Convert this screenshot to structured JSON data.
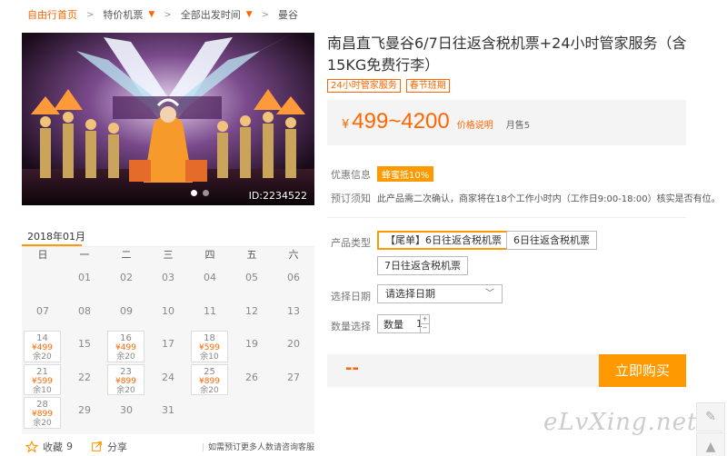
{
  "breadcrumb": {
    "items": [
      "自由行首页",
      "特价机票",
      "全部出发时间",
      "曼谷"
    ]
  },
  "hero": {
    "image_id": "ID:2234522"
  },
  "product": {
    "title": "南昌直飞曼谷6/7日往返含税机票+24小时管家服务（含15KG免费行李）",
    "tags": [
      "24小时管家服务",
      "春节班期"
    ],
    "price_symbol": "¥",
    "price_range": "499~4200",
    "price_note": "价格说明",
    "monthly_sales": "月售5"
  },
  "info": {
    "discount_label": "优惠信息",
    "discount_badge": "蜂蜜抵10%",
    "notice_label": "预订须知",
    "notice_text": "此产品需二次确认，商家将在18个工作小时内（工作日9:00-18:00）核实是否有位。"
  },
  "form": {
    "type_label": "产品类型",
    "types": [
      "【尾单】6日往返含税机票",
      "6日往返含税机票",
      "7日往返含税机票"
    ],
    "date_label": "选择日期",
    "date_placeholder": "请选择日期",
    "qty_label": "数量选择",
    "qty_inner_label": "数量",
    "qty_value": "1"
  },
  "buy": {
    "price_placeholder": "--",
    "button_label": "立即购买"
  },
  "calendar": {
    "month": "2018年01月",
    "weekdays": [
      "日",
      "一",
      "二",
      "三",
      "四",
      "五",
      "六"
    ],
    "rows": [
      [
        {
          "d": ""
        },
        {
          "d": "01"
        },
        {
          "d": "02"
        },
        {
          "d": "03"
        },
        {
          "d": "04"
        },
        {
          "d": "05"
        },
        {
          "d": "06"
        }
      ],
      [
        {
          "d": "07"
        },
        {
          "d": "08"
        },
        {
          "d": "09"
        },
        {
          "d": "10"
        },
        {
          "d": "11"
        },
        {
          "d": "12"
        },
        {
          "d": "13"
        }
      ],
      [
        {
          "d": "14",
          "p": "¥499",
          "r": "余20"
        },
        {
          "d": "15"
        },
        {
          "d": "16",
          "p": "¥499",
          "r": "余20"
        },
        {
          "d": "17"
        },
        {
          "d": "18",
          "p": "¥599",
          "r": "余10"
        },
        {
          "d": "19"
        },
        {
          "d": "20"
        }
      ],
      [
        {
          "d": "21",
          "p": "¥599",
          "r": "余10"
        },
        {
          "d": "22"
        },
        {
          "d": "23",
          "p": "¥899",
          "r": "余20"
        },
        {
          "d": "24"
        },
        {
          "d": "25",
          "p": "¥899",
          "r": "余20"
        },
        {
          "d": "26"
        },
        {
          "d": "27"
        }
      ],
      [
        {
          "d": "28",
          "p": "¥899",
          "r": "余20"
        },
        {
          "d": "29"
        },
        {
          "d": "30"
        },
        {
          "d": "31"
        },
        {
          "d": ""
        },
        {
          "d": ""
        },
        {
          "d": ""
        }
      ]
    ]
  },
  "footer": {
    "fav_label": "收藏",
    "fav_count": "9",
    "share_label": "分享",
    "note": "如需预订更多人数请咨询客服"
  },
  "watermark": "eLvXing.net",
  "colors": {
    "accent": "#ff6600",
    "button": "#ff9900"
  }
}
